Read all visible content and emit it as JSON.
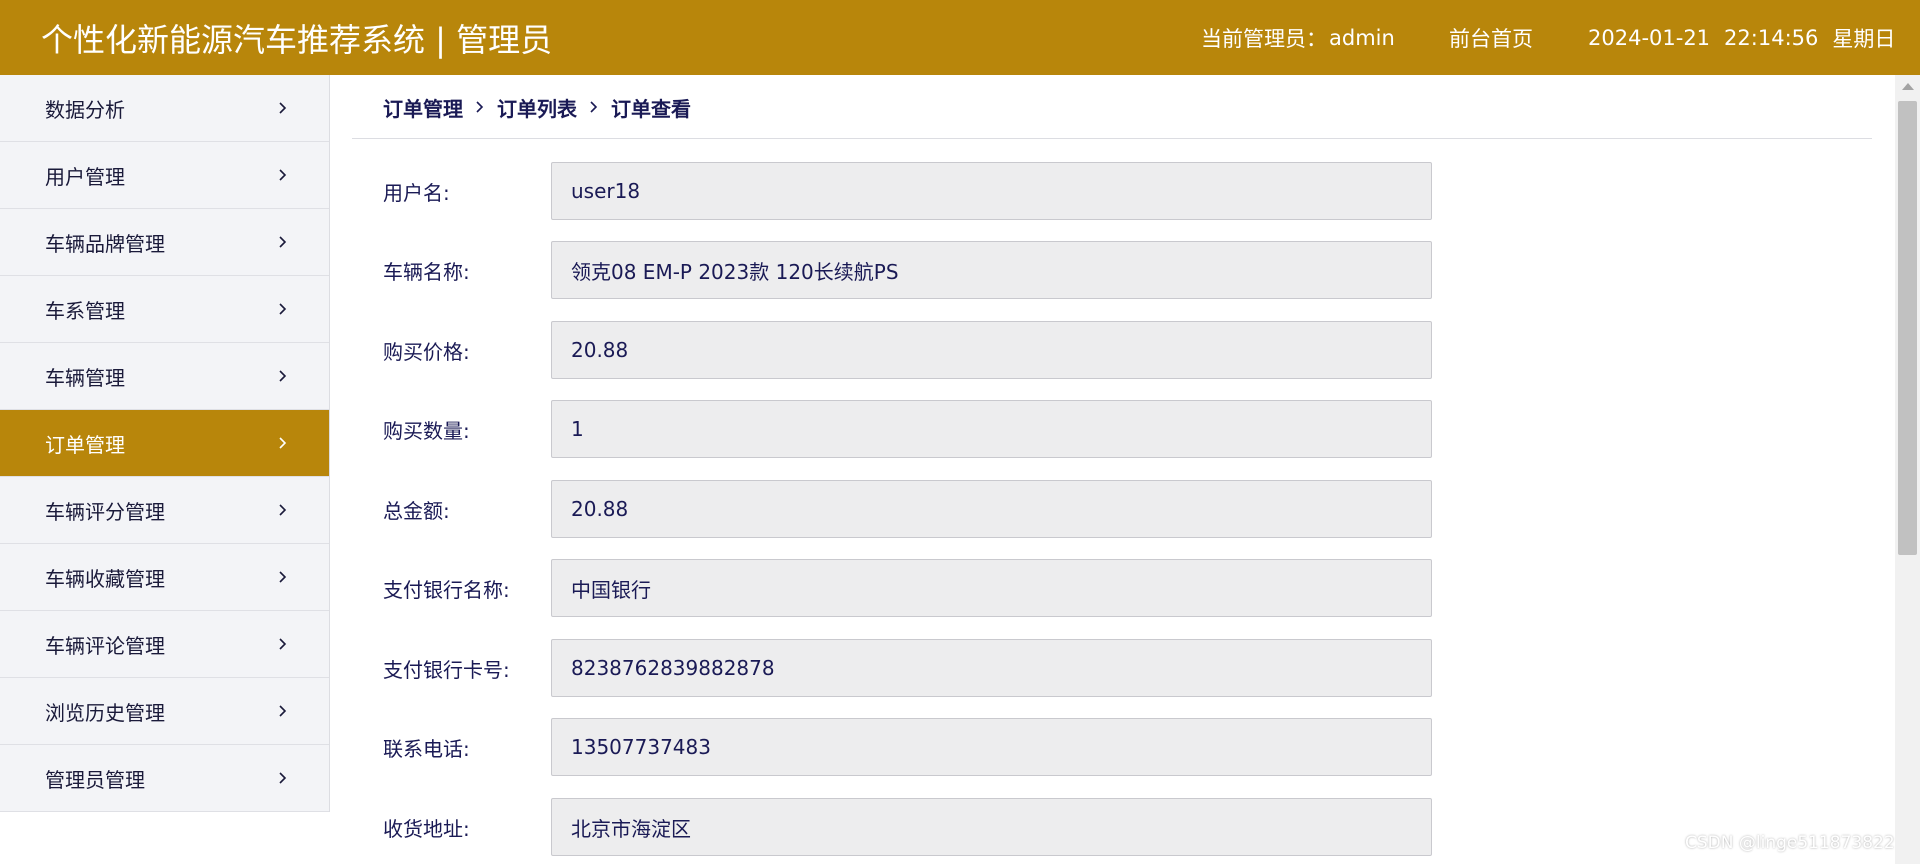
{
  "header": {
    "title": "个性化新能源汽车推荐系统 | 管理员",
    "admin_label": "当前管理员：",
    "admin_name": "admin",
    "home_link": "前台首页",
    "date": "2024-01-21",
    "time": "22:14:56",
    "weekday": "星期日"
  },
  "sidebar": {
    "items": [
      {
        "label": "数据分析"
      },
      {
        "label": "用户管理"
      },
      {
        "label": "车辆品牌管理"
      },
      {
        "label": "车系管理"
      },
      {
        "label": "车辆管理"
      },
      {
        "label": "订单管理",
        "active": true
      },
      {
        "label": "车辆评分管理"
      },
      {
        "label": "车辆收藏管理"
      },
      {
        "label": "车辆评论管理"
      },
      {
        "label": "浏览历史管理"
      },
      {
        "label": "管理员管理"
      }
    ]
  },
  "breadcrumb": [
    "订单管理",
    "订单列表",
    "订单查看"
  ],
  "form": {
    "fields": [
      {
        "label": "用户名:",
        "value": "user18"
      },
      {
        "label": "车辆名称:",
        "value": "领克08 EM-P 2023款 120长续航PS"
      },
      {
        "label": "购买价格:",
        "value": "20.88"
      },
      {
        "label": "购买数量:",
        "value": "1"
      },
      {
        "label": "总金额:",
        "value": "20.88"
      },
      {
        "label": "支付银行名称:",
        "value": "中国银行"
      },
      {
        "label": "支付银行卡号:",
        "value": "8238762839882878"
      },
      {
        "label": "联系电话:",
        "value": "13507737483"
      },
      {
        "label": "收货地址:",
        "value": "北京市海淀区"
      }
    ]
  },
  "watermark": "CSDN @linge511873822",
  "colors": {
    "accent": "#b8860b",
    "sidebar_bg": "#f3f4f7",
    "field_bg": "#ededee",
    "text": "#1a1a55"
  }
}
